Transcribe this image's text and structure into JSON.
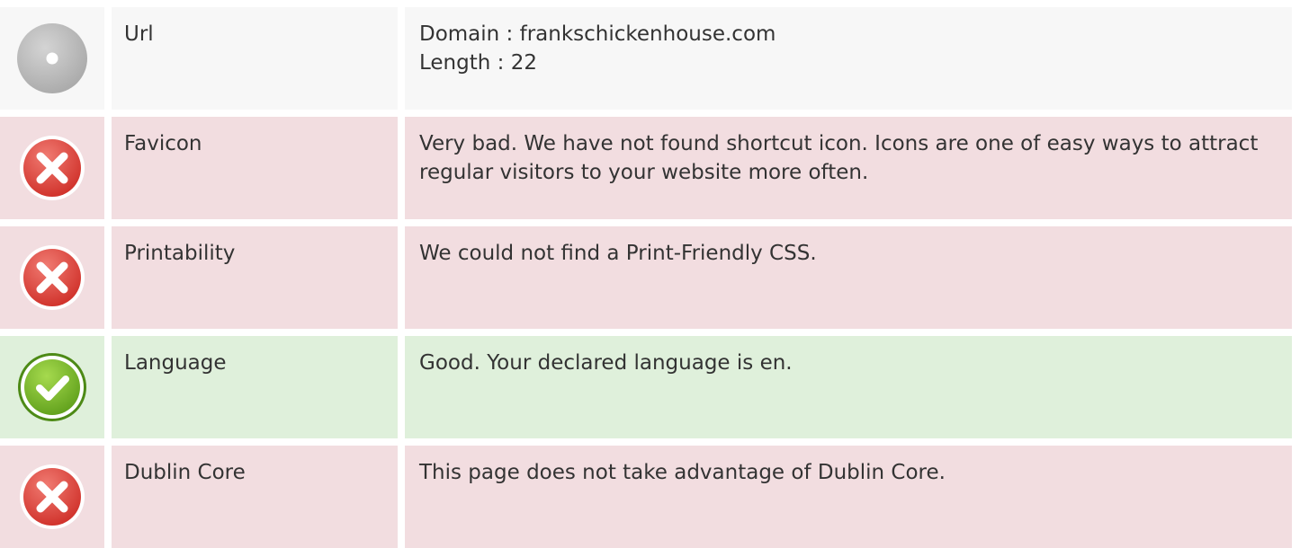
{
  "rows": [
    {
      "status": "neutral",
      "icon": "neutral-circle-icon",
      "label": "Url",
      "lines": [
        "Domain : frankschickenhouse.com",
        "Length : 22"
      ]
    },
    {
      "status": "bad",
      "icon": "error-x-icon",
      "label": "Favicon",
      "lines": [
        "Very bad. We have not found shortcut icon. Icons are one of easy ways to attract regular visitors to your website more often."
      ]
    },
    {
      "status": "bad",
      "icon": "error-x-icon",
      "label": "Printability",
      "lines": [
        "We could not find a Print-Friendly CSS."
      ]
    },
    {
      "status": "good",
      "icon": "success-check-icon",
      "label": "Language",
      "lines": [
        "Good. Your declared language is en."
      ]
    },
    {
      "status": "bad",
      "icon": "error-x-icon",
      "label": "Dublin Core",
      "lines": [
        "This page does not take advantage of Dublin Core."
      ]
    }
  ],
  "colors": {
    "neutral_bg": "#f7f7f7",
    "bad_bg": "#f2dde0",
    "good_bg": "#dff0db",
    "error_red": "#e04b43",
    "success_green": "#7cbf2f",
    "neutral_gray": "#b9b9b9",
    "text": "#333333"
  }
}
